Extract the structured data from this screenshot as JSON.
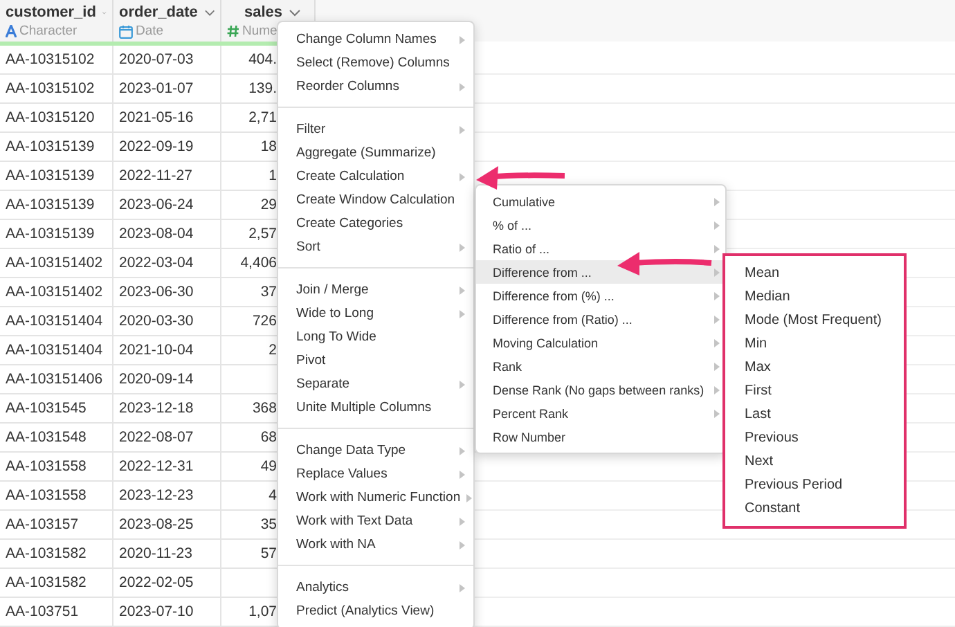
{
  "table": {
    "columns": [
      {
        "name": "customer_id",
        "type_label": "Character",
        "kind": "character"
      },
      {
        "name": "order_date",
        "type_label": "Date",
        "kind": "date"
      },
      {
        "name": "sales",
        "type_label": "Nume",
        "kind": "numeric"
      }
    ],
    "rows": [
      [
        "AA-10315102",
        "2020-07-03",
        "404."
      ],
      [
        "AA-10315102",
        "2023-01-07",
        "139."
      ],
      [
        "AA-10315120",
        "2021-05-16",
        "2,71"
      ],
      [
        "AA-10315139",
        "2022-09-19",
        "18"
      ],
      [
        "AA-10315139",
        "2022-11-27",
        "1"
      ],
      [
        "AA-10315139",
        "2023-06-24",
        "29"
      ],
      [
        "AA-10315139",
        "2023-08-04",
        "2,57"
      ],
      [
        "AA-103151402",
        "2022-03-04",
        "4,406"
      ],
      [
        "AA-103151402",
        "2023-06-30",
        "37"
      ],
      [
        "AA-103151404",
        "2020-03-30",
        "726"
      ],
      [
        "AA-103151404",
        "2021-10-04",
        "2"
      ],
      [
        "AA-103151406",
        "2020-09-14",
        null
      ],
      [
        "AA-1031545",
        "2023-12-18",
        "368"
      ],
      [
        "AA-1031548",
        "2022-08-07",
        "68"
      ],
      [
        "AA-1031558",
        "2022-12-31",
        "49"
      ],
      [
        "AA-1031558",
        "2023-12-23",
        "4"
      ],
      [
        "AA-103157",
        "2023-08-25",
        "35"
      ],
      [
        "AA-1031582",
        "2020-11-23",
        "57"
      ],
      [
        "AA-1031582",
        "2022-02-05",
        null
      ],
      [
        "AA-103751",
        "2023-07-10",
        "1,07"
      ]
    ]
  },
  "column_menu": {
    "sections": [
      [
        {
          "label": "Change Column Names",
          "submenu": true
        },
        {
          "label": "Select (Remove) Columns",
          "submenu": false
        },
        {
          "label": "Reorder Columns",
          "submenu": true
        }
      ],
      [
        {
          "label": "Filter",
          "submenu": true
        },
        {
          "label": "Aggregate (Summarize)",
          "submenu": false
        },
        {
          "label": "Create Calculation",
          "submenu": true
        },
        {
          "label": "Create Window Calculation",
          "submenu": false
        },
        {
          "label": "Create Categories",
          "submenu": false
        },
        {
          "label": "Sort",
          "submenu": true
        }
      ],
      [
        {
          "label": "Join / Merge",
          "submenu": true
        },
        {
          "label": "Wide to Long",
          "submenu": true
        },
        {
          "label": "Long To Wide",
          "submenu": false
        },
        {
          "label": "Pivot",
          "submenu": false
        },
        {
          "label": "Separate",
          "submenu": true
        },
        {
          "label": "Unite Multiple Columns",
          "submenu": false
        }
      ],
      [
        {
          "label": "Change Data Type",
          "submenu": true
        },
        {
          "label": "Replace Values",
          "submenu": true
        },
        {
          "label": "Work with Numeric Function",
          "submenu": true
        },
        {
          "label": "Work with Text Data",
          "submenu": true
        },
        {
          "label": "Work with NA",
          "submenu": true
        }
      ],
      [
        {
          "label": "Analytics",
          "submenu": true
        },
        {
          "label": "Predict (Analytics View)",
          "submenu": false
        }
      ]
    ]
  },
  "window_calculation_menu": {
    "items": [
      {
        "label": "Cumulative",
        "submenu": true,
        "selected": false
      },
      {
        "label": "% of ...",
        "submenu": true,
        "selected": false
      },
      {
        "label": "Ratio of ...",
        "submenu": true,
        "selected": false
      },
      {
        "label": "Difference from ...",
        "submenu": true,
        "selected": true
      },
      {
        "label": "Difference from (%) ...",
        "submenu": true,
        "selected": false
      },
      {
        "label": "Difference from (Ratio) ...",
        "submenu": true,
        "selected": false
      },
      {
        "label": "Moving Calculation",
        "submenu": true,
        "selected": false
      },
      {
        "label": "Rank",
        "submenu": true,
        "selected": false
      },
      {
        "label": "Dense Rank (No gaps between ranks)",
        "submenu": true,
        "selected": false
      },
      {
        "label": "Percent Rank",
        "submenu": true,
        "selected": false
      },
      {
        "label": "Row Number",
        "submenu": false,
        "selected": false
      }
    ]
  },
  "difference_from_menu": {
    "items": [
      "Mean",
      "Median",
      "Mode (Most Frequent)",
      "Min",
      "Max",
      "First",
      "Last",
      "Previous",
      "Next",
      "Previous Period",
      "Constant"
    ]
  }
}
